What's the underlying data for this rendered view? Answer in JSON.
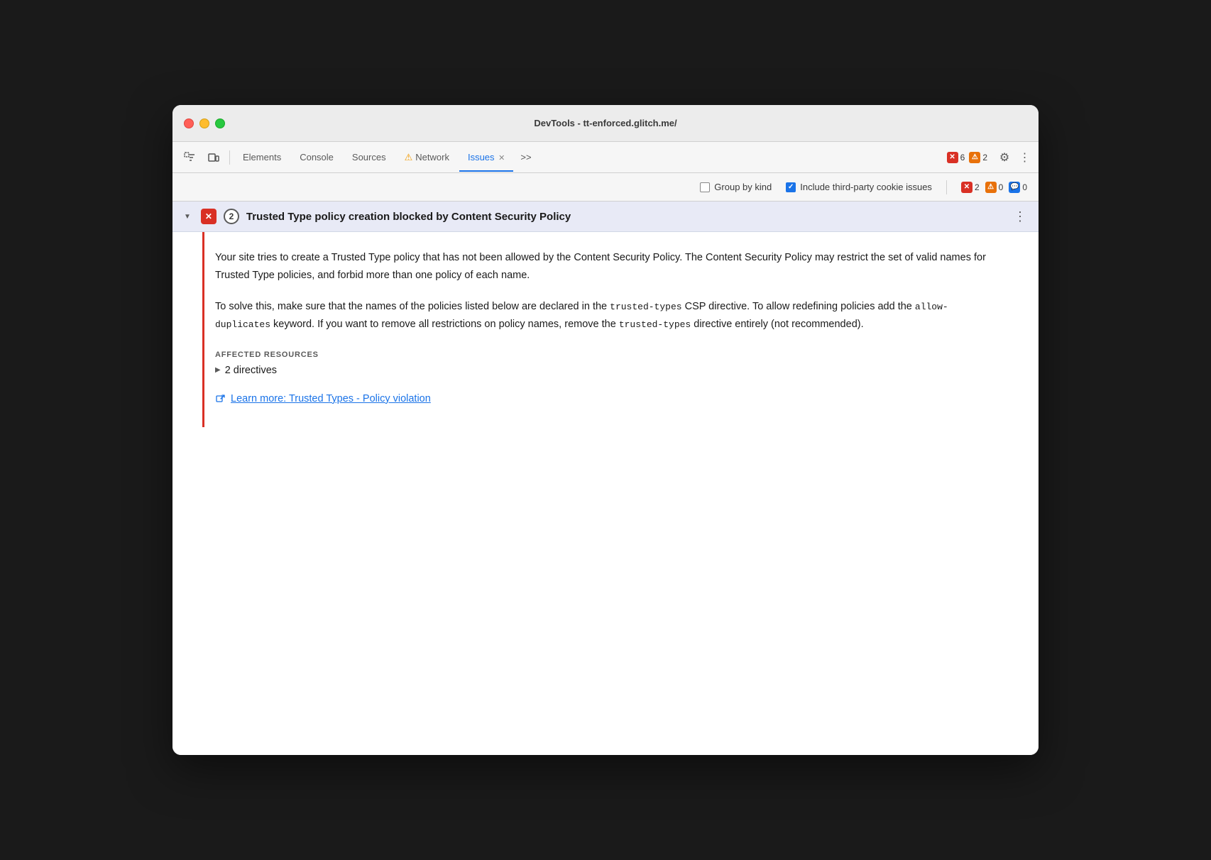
{
  "window": {
    "title": "DevTools - tt-enforced.glitch.me/"
  },
  "toolbar": {
    "tabs": [
      {
        "id": "elements",
        "label": "Elements",
        "active": false
      },
      {
        "id": "console",
        "label": "Console",
        "active": false
      },
      {
        "id": "sources",
        "label": "Sources",
        "active": false
      },
      {
        "id": "network",
        "label": "Network",
        "active": false,
        "warning": true
      },
      {
        "id": "issues",
        "label": "Issues",
        "active": true
      }
    ],
    "more_tabs_label": ">>",
    "error_count": "6",
    "warning_count": "2",
    "gear_icon": "⚙",
    "more_icon": "⋮"
  },
  "filter_bar": {
    "group_by_kind_label": "Group by kind",
    "group_by_kind_checked": false,
    "include_third_party_label": "Include third-party cookie issues",
    "include_third_party_checked": true,
    "badge_error_count": "2",
    "badge_warning_count": "0",
    "badge_info_count": "0"
  },
  "issue": {
    "title": "Trusted Type policy creation blocked by Content Security Policy",
    "count": "2",
    "description": "Your site tries to create a Trusted Type policy that has not been allowed by the Content Security Policy. The Content Security Policy may restrict the set of valid names for Trusted Type policies, and forbid more than one policy of each name.",
    "solution_prefix": "To solve this, make sure that the names of the policies listed below are declared in the ",
    "solution_code1": "trusted-types",
    "solution_middle": " CSP directive. To allow redefining policies add the ",
    "solution_code2": "allow-\nduplicates",
    "solution_suffix": " keyword. If you want to remove all restrictions on policy names, remove the ",
    "solution_code3": "trusted-types",
    "solution_end": " directive entirely (not recommended).",
    "affected_resources_label": "AFFECTED RESOURCES",
    "directives_label": "2 directives",
    "learn_more_text": "Learn more: Trusted Types - Policy violation"
  }
}
